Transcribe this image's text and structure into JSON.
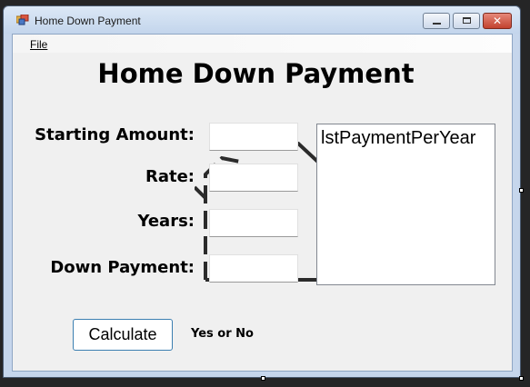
{
  "window": {
    "title": "Home Down Payment"
  },
  "menu": {
    "file_label": "File"
  },
  "form": {
    "title": "Home Down Payment",
    "starting_amount_label": "Starting Amount:",
    "rate_label": "Rate:",
    "years_label": "Years:",
    "down_payment_label": "Down Payment:",
    "starting_amount_value": "",
    "rate_value": "",
    "years_value": "",
    "down_payment_value": "",
    "list_text": "lstPaymentPerYear",
    "calculate_label": "Calculate",
    "yes_no_text": "Yes or No"
  },
  "colors": {
    "form_background": "#f0f0f0",
    "button_border": "#3c7fb1",
    "close_button": "#c2422f"
  },
  "icons": [
    "app-icon",
    "minimize-icon",
    "maximize-icon",
    "close-icon",
    "house-outline-icon"
  ]
}
